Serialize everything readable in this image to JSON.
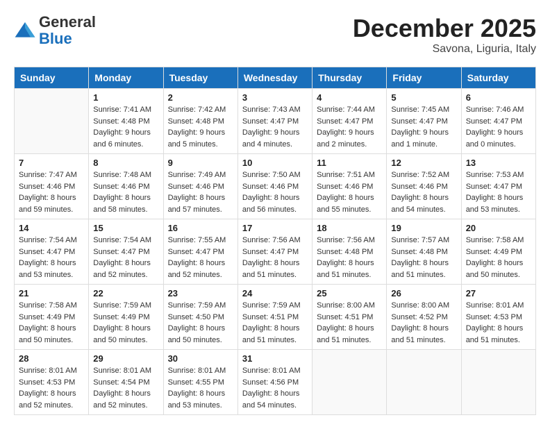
{
  "header": {
    "logo_general": "General",
    "logo_blue": "Blue",
    "month_title": "December 2025",
    "location": "Savona, Liguria, Italy"
  },
  "weekdays": [
    "Sunday",
    "Monday",
    "Tuesday",
    "Wednesday",
    "Thursday",
    "Friday",
    "Saturday"
  ],
  "weeks": [
    [
      {
        "day": "",
        "info": ""
      },
      {
        "day": "1",
        "info": "Sunrise: 7:41 AM\nSunset: 4:48 PM\nDaylight: 9 hours\nand 6 minutes."
      },
      {
        "day": "2",
        "info": "Sunrise: 7:42 AM\nSunset: 4:48 PM\nDaylight: 9 hours\nand 5 minutes."
      },
      {
        "day": "3",
        "info": "Sunrise: 7:43 AM\nSunset: 4:47 PM\nDaylight: 9 hours\nand 4 minutes."
      },
      {
        "day": "4",
        "info": "Sunrise: 7:44 AM\nSunset: 4:47 PM\nDaylight: 9 hours\nand 2 minutes."
      },
      {
        "day": "5",
        "info": "Sunrise: 7:45 AM\nSunset: 4:47 PM\nDaylight: 9 hours\nand 1 minute."
      },
      {
        "day": "6",
        "info": "Sunrise: 7:46 AM\nSunset: 4:47 PM\nDaylight: 9 hours\nand 0 minutes."
      }
    ],
    [
      {
        "day": "7",
        "info": "Sunrise: 7:47 AM\nSunset: 4:46 PM\nDaylight: 8 hours\nand 59 minutes."
      },
      {
        "day": "8",
        "info": "Sunrise: 7:48 AM\nSunset: 4:46 PM\nDaylight: 8 hours\nand 58 minutes."
      },
      {
        "day": "9",
        "info": "Sunrise: 7:49 AM\nSunset: 4:46 PM\nDaylight: 8 hours\nand 57 minutes."
      },
      {
        "day": "10",
        "info": "Sunrise: 7:50 AM\nSunset: 4:46 PM\nDaylight: 8 hours\nand 56 minutes."
      },
      {
        "day": "11",
        "info": "Sunrise: 7:51 AM\nSunset: 4:46 PM\nDaylight: 8 hours\nand 55 minutes."
      },
      {
        "day": "12",
        "info": "Sunrise: 7:52 AM\nSunset: 4:46 PM\nDaylight: 8 hours\nand 54 minutes."
      },
      {
        "day": "13",
        "info": "Sunrise: 7:53 AM\nSunset: 4:47 PM\nDaylight: 8 hours\nand 53 minutes."
      }
    ],
    [
      {
        "day": "14",
        "info": "Sunrise: 7:54 AM\nSunset: 4:47 PM\nDaylight: 8 hours\nand 53 minutes."
      },
      {
        "day": "15",
        "info": "Sunrise: 7:54 AM\nSunset: 4:47 PM\nDaylight: 8 hours\nand 52 minutes."
      },
      {
        "day": "16",
        "info": "Sunrise: 7:55 AM\nSunset: 4:47 PM\nDaylight: 8 hours\nand 52 minutes."
      },
      {
        "day": "17",
        "info": "Sunrise: 7:56 AM\nSunset: 4:47 PM\nDaylight: 8 hours\nand 51 minutes."
      },
      {
        "day": "18",
        "info": "Sunrise: 7:56 AM\nSunset: 4:48 PM\nDaylight: 8 hours\nand 51 minutes."
      },
      {
        "day": "19",
        "info": "Sunrise: 7:57 AM\nSunset: 4:48 PM\nDaylight: 8 hours\nand 51 minutes."
      },
      {
        "day": "20",
        "info": "Sunrise: 7:58 AM\nSunset: 4:49 PM\nDaylight: 8 hours\nand 50 minutes."
      }
    ],
    [
      {
        "day": "21",
        "info": "Sunrise: 7:58 AM\nSunset: 4:49 PM\nDaylight: 8 hours\nand 50 minutes."
      },
      {
        "day": "22",
        "info": "Sunrise: 7:59 AM\nSunset: 4:49 PM\nDaylight: 8 hours\nand 50 minutes."
      },
      {
        "day": "23",
        "info": "Sunrise: 7:59 AM\nSunset: 4:50 PM\nDaylight: 8 hours\nand 50 minutes."
      },
      {
        "day": "24",
        "info": "Sunrise: 7:59 AM\nSunset: 4:51 PM\nDaylight: 8 hours\nand 51 minutes."
      },
      {
        "day": "25",
        "info": "Sunrise: 8:00 AM\nSunset: 4:51 PM\nDaylight: 8 hours\nand 51 minutes."
      },
      {
        "day": "26",
        "info": "Sunrise: 8:00 AM\nSunset: 4:52 PM\nDaylight: 8 hours\nand 51 minutes."
      },
      {
        "day": "27",
        "info": "Sunrise: 8:01 AM\nSunset: 4:53 PM\nDaylight: 8 hours\nand 51 minutes."
      }
    ],
    [
      {
        "day": "28",
        "info": "Sunrise: 8:01 AM\nSunset: 4:53 PM\nDaylight: 8 hours\nand 52 minutes."
      },
      {
        "day": "29",
        "info": "Sunrise: 8:01 AM\nSunset: 4:54 PM\nDaylight: 8 hours\nand 52 minutes."
      },
      {
        "day": "30",
        "info": "Sunrise: 8:01 AM\nSunset: 4:55 PM\nDaylight: 8 hours\nand 53 minutes."
      },
      {
        "day": "31",
        "info": "Sunrise: 8:01 AM\nSunset: 4:56 PM\nDaylight: 8 hours\nand 54 minutes."
      },
      {
        "day": "",
        "info": ""
      },
      {
        "day": "",
        "info": ""
      },
      {
        "day": "",
        "info": ""
      }
    ]
  ]
}
